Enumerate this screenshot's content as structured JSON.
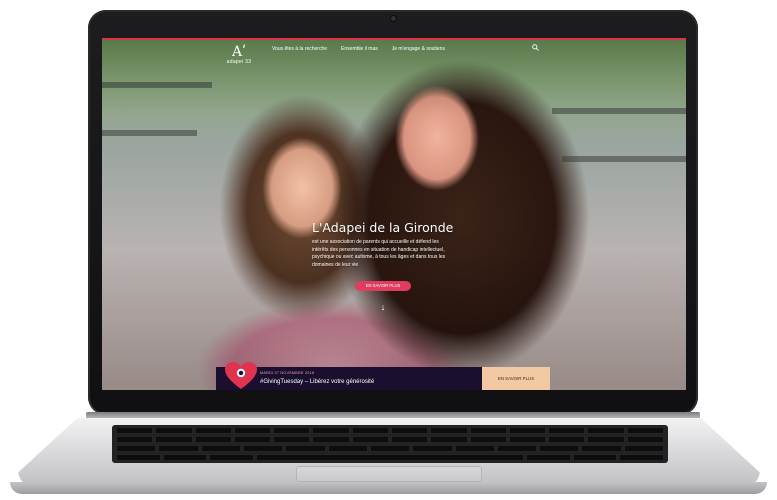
{
  "site": {
    "logo_mark": "Aʹ",
    "logo_text": "adapei 33",
    "nav": [
      "Vous êtes à la recherche",
      "Ensemble il mas",
      "Je m'engage & soutiens"
    ]
  },
  "hero": {
    "title": "L'Adapei de la Gironde",
    "description": "est une association de parents qui accueille et défend les intérêts des personnes en situation de handicap intellectuel, psychique ou avec autisme, à tous les âges et dans tous les domaines de leur vie",
    "cta": "EN SAVOIR PLUS",
    "scroll_arrow": "↓"
  },
  "banner": {
    "date": "MARDI 27 NOVEMBRE 2018",
    "title": "#GivingTuesday – Libérez votre générosité",
    "cta": "EN SAVOIR PLUS"
  },
  "colors": {
    "accent": "#de3d60",
    "banner_bg": "#1a0f2e",
    "banner_cta_bg": "#f3c9a4"
  }
}
